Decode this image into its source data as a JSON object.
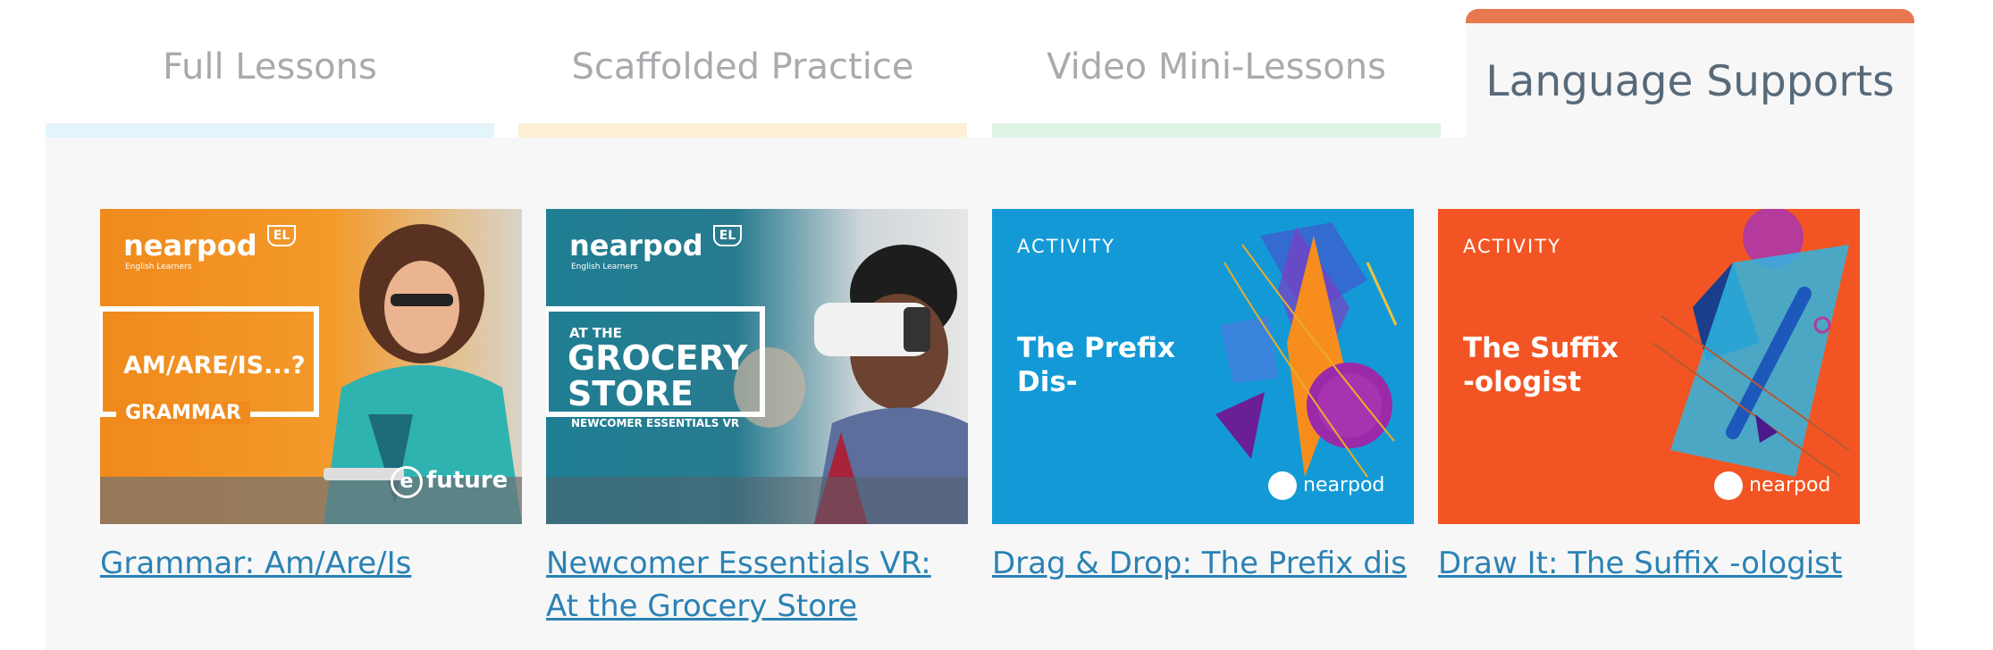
{
  "tabs": [
    {
      "label": "Full Lessons",
      "accent": "#e3f4fb"
    },
    {
      "label": "Scaffolded Practice",
      "accent": "#fdf0d6"
    },
    {
      "label": "Video Mini-Lessons",
      "accent": "#dff4e5"
    },
    {
      "label": "Language Supports",
      "accent": "#e8784f",
      "active": true
    }
  ],
  "cards": [
    {
      "link": "Grammar: Am/Are/Is",
      "thumb": {
        "brand": "nearpod",
        "badge": "EL",
        "sub": "English Learners",
        "line1": "AM/ARE/IS...?",
        "line2": "GRAMMAR",
        "partner": "future",
        "bg": "#f08a1c"
      }
    },
    {
      "link": "Newcomer Essentials VR: At the Grocery Store",
      "thumb": {
        "brand": "nearpod",
        "badge": "EL",
        "sub": "English Learners",
        "pre": "AT THE",
        "line1": "GROCERY",
        "line2": "STORE",
        "line3": "NEWCOMER ESSENTIALS VR",
        "bg": "#1f7e93"
      }
    },
    {
      "link": "Drag & Drop: The Prefix dis",
      "thumb": {
        "kind": "ACTIVITY",
        "title1": "The Prefix",
        "title2": "Dis-",
        "brand": "nearpod",
        "bg": "#139ad6"
      }
    },
    {
      "link": "Draw It: The Suffix -ologist",
      "thumb": {
        "kind": "ACTIVITY",
        "title1": "The Suffix",
        "title2": "-ologist",
        "brand": "nearpod",
        "bg": "#f25523"
      }
    }
  ]
}
